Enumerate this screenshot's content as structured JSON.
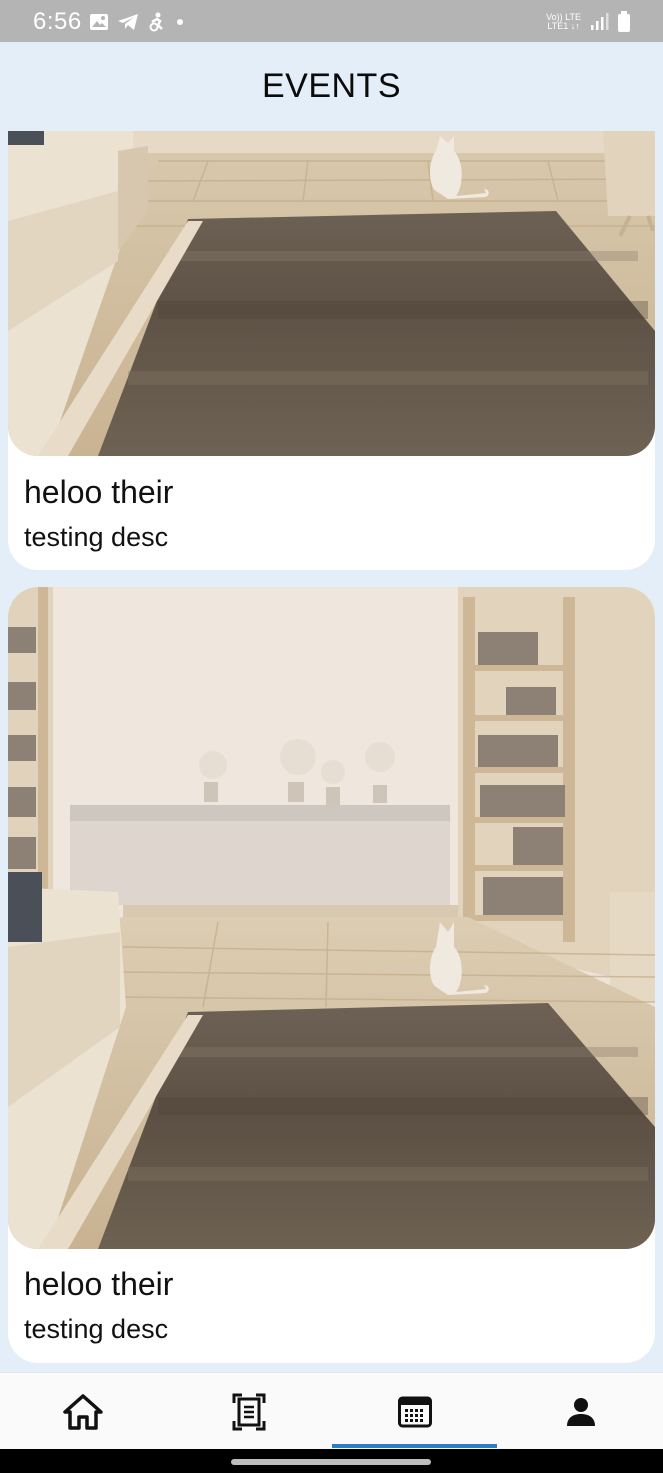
{
  "status_bar": {
    "time": "6:56",
    "network_top": "Vo)) LTE",
    "network_bottom": "LTE1 ↓↑",
    "icons_left": [
      "image-icon",
      "telegram-icon",
      "accessibility-icon",
      "dot-icon"
    ],
    "icons_right": [
      "signal-icon",
      "battery-icon"
    ]
  },
  "header": {
    "title": "EVENTS"
  },
  "events": [
    {
      "title": "heloo their",
      "description": "testing desc"
    },
    {
      "title": "heloo their",
      "description": "testing desc"
    }
  ],
  "bottom_nav": {
    "items": [
      "home-icon",
      "document-scan-icon",
      "calendar-icon",
      "person-icon"
    ],
    "active_index": 2,
    "active_color": "#2a7fc4"
  }
}
